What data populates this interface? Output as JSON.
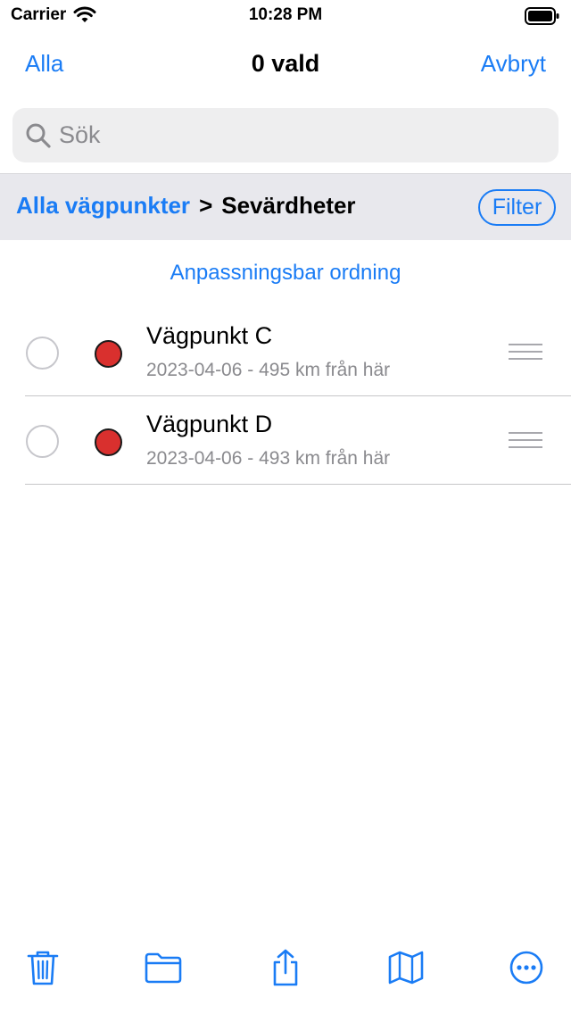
{
  "status_bar": {
    "carrier": "Carrier",
    "time": "10:28 PM"
  },
  "nav": {
    "left_label": "Alla",
    "title": "0 vald",
    "right_label": "Avbryt"
  },
  "search": {
    "placeholder": "Sök",
    "value": ""
  },
  "filter_bar": {
    "breadcrumb_parent": "Alla vägpunkter",
    "breadcrumb_separator": ">",
    "breadcrumb_current": "Sevärdheter",
    "filter_label": "Filter"
  },
  "sort_label": "Anpassningsbar ordning",
  "waypoints": [
    {
      "name": "Vägpunkt C",
      "details": "2023-04-06 - 495 km från här",
      "marker_color": "#d9302e"
    },
    {
      "name": "Vägpunkt D",
      "details": "2023-04-06 - 493 km från här",
      "marker_color": "#d9302e"
    }
  ],
  "toolbar": {
    "icons": [
      "trash-icon",
      "folder-icon",
      "share-icon",
      "map-icon",
      "more-icon"
    ]
  },
  "colors": {
    "accent": "#1a7cf5",
    "marker": "#d9302e",
    "secondary_text": "#8a8a8e"
  }
}
